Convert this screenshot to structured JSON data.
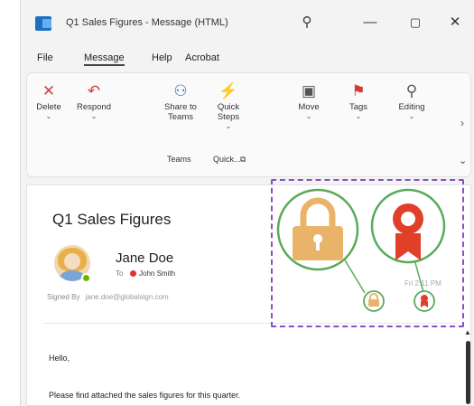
{
  "window": {
    "title": "Q1 Sales Figures - Message (HTML)",
    "search_glyph": "⚲",
    "minimize_glyph": "—",
    "maximize_glyph": "▢",
    "close_glyph": "✕"
  },
  "menu": {
    "items": [
      "File",
      "Message",
      "Help",
      "Acrobat"
    ],
    "active": "Message"
  },
  "ribbon": {
    "buttons": [
      {
        "label": "Delete",
        "icon": "delete-x-icon",
        "glyph": "✕",
        "caret": "⌄"
      },
      {
        "label": "Respond",
        "icon": "reply-arrow-icon",
        "glyph": "↶",
        "caret": "⌄"
      },
      {
        "label": "Share to Teams",
        "icon": "teams-icon",
        "glyph": "⚇",
        "caret": ""
      },
      {
        "label": "Quick Steps",
        "icon": "lightning-icon",
        "glyph": "⚡",
        "caret": "⌄"
      },
      {
        "label": "Move",
        "icon": "folder-move-icon",
        "glyph": "▣",
        "caret": "⌄"
      },
      {
        "label": "Tags",
        "icon": "flag-icon",
        "glyph": "⚑",
        "caret": "⌄"
      },
      {
        "label": "Editing",
        "icon": "search-icon",
        "glyph": "⚲",
        "caret": "⌄"
      }
    ],
    "groups": [
      "Teams",
      "Quick..."
    ],
    "launcher_glyph": "⧉",
    "more_glyph": "›",
    "collapse_glyph": "⌄"
  },
  "message": {
    "subject": "Q1 Sales Figures",
    "sender": "Jane Doe",
    "to_label": "To",
    "to_name": "John Smith",
    "signed_by_label": "Signed By",
    "signed_by_email": "jane.doe@globalsign.com",
    "time": "Fri 2:11 PM",
    "body": [
      "Hello,",
      "Please find attached the sales figures for this quarter."
    ]
  },
  "colors": {
    "highlight_border": "#8a4fc0",
    "circle_green": "#5aaa5a",
    "lock_gold": "#e9b46a",
    "ribbon_red": "#e0402a"
  }
}
